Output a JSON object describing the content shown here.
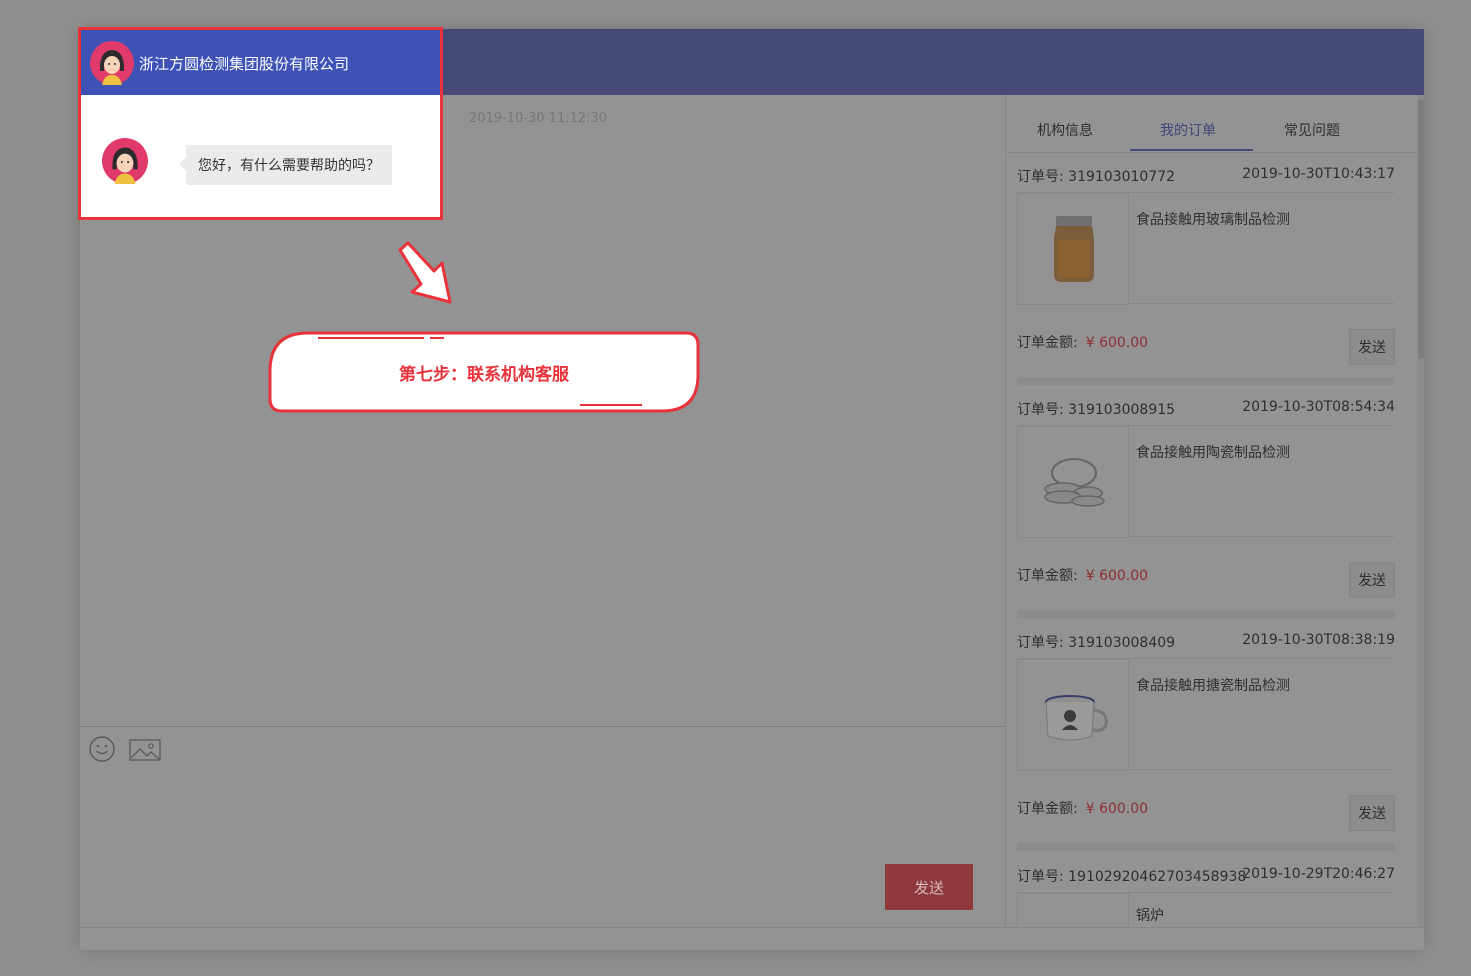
{
  "popup": {
    "company_name": "浙江方圆检测集团股份有限公司",
    "greeting": "您好，有什么需要帮助的吗？"
  },
  "chat": {
    "timestamp": "2019-10-30 11:12:30",
    "send_label": "发送"
  },
  "callout": {
    "text": "第七步：联系机构客服"
  },
  "tabs": [
    {
      "label": "机构信息"
    },
    {
      "label": "我的订单",
      "active": true
    },
    {
      "label": "常见问题"
    }
  ],
  "orders": [
    {
      "order_no": "订单号: 319103010772",
      "time": "2019-10-30T10:43:17",
      "product": "食品接触用玻璃制品检测",
      "amount_label": "订单金额:",
      "amount": "¥ 600.00",
      "send_label": "发送"
    },
    {
      "order_no": "订单号: 319103008915",
      "time": "2019-10-30T08:54:34",
      "product": "食品接触用陶瓷制品检测",
      "amount_label": "订单金额:",
      "amount": "¥ 600.00",
      "send_label": "发送"
    },
    {
      "order_no": "订单号: 319103008409",
      "time": "2019-10-30T08:38:19",
      "product": "食品接触用搪瓷制品检测",
      "amount_label": "订单金额:",
      "amount": "¥ 600.00",
      "send_label": "发送"
    },
    {
      "order_no": "订单号: 19102920462703458938",
      "time": "2019-10-29T20:46:27",
      "product": "锅炉"
    }
  ],
  "icons": {
    "emoji": "smiley-icon",
    "image": "image-icon",
    "arrow": "arrow-down-right-icon"
  },
  "colors": {
    "header_blue": "#3e51b5",
    "topbar": "#454b76",
    "highlight_red": "#e8333b",
    "price_red": "#8e3032"
  }
}
